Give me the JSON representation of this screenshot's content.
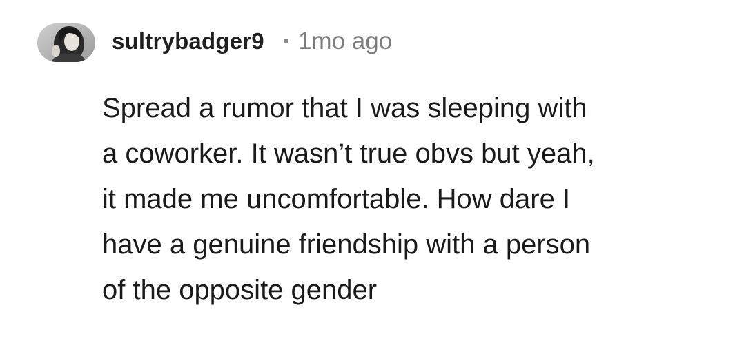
{
  "comment": {
    "author": "sultrybadger9",
    "separator": "•",
    "timestamp": "1mo ago",
    "avatar_icon": "user-avatar-photo",
    "body": "Spread a rumor that I was sleeping with\na coworker. It wasn’t true obvs but yeah,\nit made me uncomfortable. How dare I\nhave a genuine friendship with a person\nof the opposite gender"
  }
}
